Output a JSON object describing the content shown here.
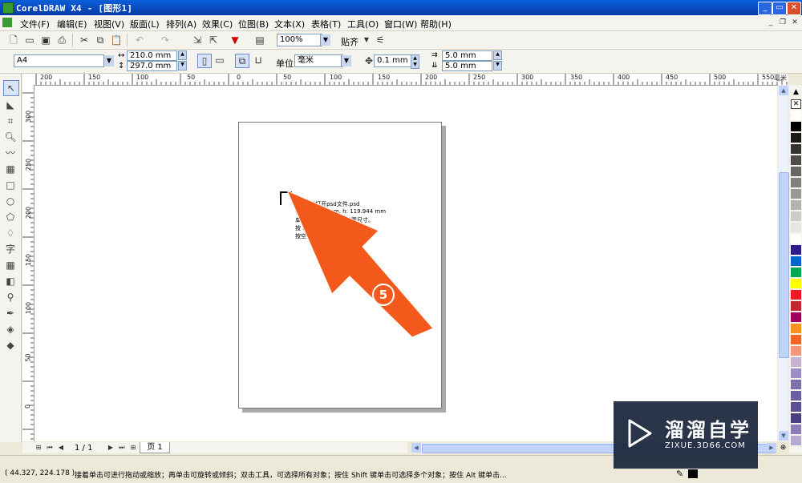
{
  "window": {
    "title": "CorelDRAW X4 - [图形1]"
  },
  "menu": [
    "文件(F)",
    "编辑(E)",
    "视图(V)",
    "版面(L)",
    "排列(A)",
    "效果(C)",
    "位图(B)",
    "文本(X)",
    "表格(T)",
    "工具(O)",
    "窗口(W)",
    "帮助(H)"
  ],
  "toolbar": {
    "zoom": "100%",
    "snap_label": "贴齐"
  },
  "property_bar": {
    "page_size": "A4",
    "width": "210.0 mm",
    "height": "297.0 mm",
    "unit_label": "单位:",
    "unit": "毫米",
    "nudge": "0.1 mm",
    "dup_x": "5.0 mm",
    "dup_y": "5.0 mm"
  },
  "ruler": {
    "h_labels": [
      "200",
      "150",
      "100",
      "50",
      "0",
      "50",
      "100",
      "150",
      "200",
      "250",
      "300",
      "350",
      "400",
      "450",
      "500",
      "550"
    ],
    "unit": "毫米",
    "v_labels": [
      "300",
      "250",
      "200",
      "150",
      "100",
      "50",
      "0"
    ]
  },
  "doc_text": {
    "line1": "cdr怎样打开psd文件.psd",
    "line2": "w: 160.161 mm, h: 119.944 mm",
    "line3": "单击并拖动以便重新设置尺寸。",
    "line4": "按 Enter 可以居中。",
    "line5": "按空格以使用原始位置。"
  },
  "callout": {
    "number": "5",
    "color": "#f2591a"
  },
  "page_nav": {
    "count": "1 / 1",
    "tab": "页 1"
  },
  "status": {
    "coords": "( 44.327, 224.178 )",
    "hint": "接着单击可进行拖动或缩放；再单击可旋转或倾斜；双击工具，可选择所有对象；按住 Shift 键单击可选择多个对象；按住 Alt 键单击..."
  },
  "watermark": {
    "brand": "溜溜自学",
    "url": "ZIXUE.3D66.COM"
  },
  "palette": [
    "#ffffff",
    "#000000",
    "#1a1a1a",
    "#333333",
    "#4d4d4d",
    "#666666",
    "#808080",
    "#999999",
    "#b3b3b3",
    "#cccccc",
    "#e6e6e6",
    "#ffffff",
    "#2e1a8c",
    "#0066cc",
    "#00a651",
    "#ffff00",
    "#ed1c24",
    "#c1272d",
    "#9e005d",
    "#f7941d",
    "#f26522",
    "#f69679",
    "#c7b2d6",
    "#9b8ec4",
    "#7b6fb0",
    "#6a5fa0",
    "#5d5090",
    "#4a4080",
    "#8b7cc0",
    "#b4aad4"
  ]
}
